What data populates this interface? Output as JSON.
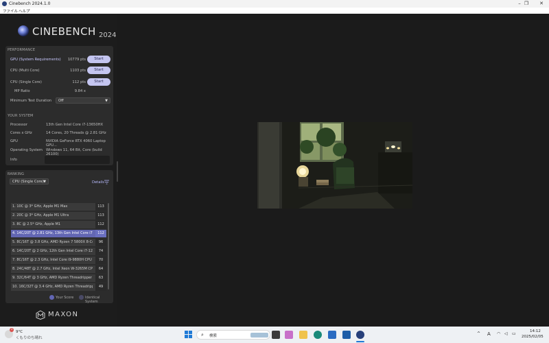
{
  "window": {
    "title": "Cinebench 2024.1.0",
    "minimize": "–",
    "maximize": "❐",
    "close": "✕"
  },
  "menu": {
    "file": "ファイル",
    "help": "ヘルプ"
  },
  "logo": {
    "name": "CINEBENCH",
    "year": "2024"
  },
  "performance": {
    "title": "PERFORMANCE",
    "gpu": {
      "label": "GPU (System Requirements)",
      "value": "10779 pts",
      "button": "Start"
    },
    "cpu_multi": {
      "label": "CPU (Multi Core)",
      "value": "1103 pts",
      "button": "Start"
    },
    "cpu_single": {
      "label": "CPU (Single Core)",
      "value": "112 pts",
      "button": "Start"
    },
    "mp_ratio": {
      "label": "MP Ratio",
      "value": "9.84 x"
    },
    "min_duration": {
      "label": "Minimum Test Duration",
      "value": "Off"
    }
  },
  "system": {
    "title": "YOUR SYSTEM",
    "processor": {
      "label": "Processor",
      "value": "13th Gen Intel Core i7-13650HX"
    },
    "cores": {
      "label": "Cores x GHz",
      "value": "14 Cores, 20 Threads @ 2.81 GHz"
    },
    "gpu": {
      "label": "GPU",
      "value": "NVIDIA GeForce RTX 4060 Laptop GPU..."
    },
    "os": {
      "label": "Operating System",
      "value": "Windows 11, 64 Bit, Core (build 26100)"
    },
    "info": {
      "label": "Info",
      "value": ""
    }
  },
  "ranking": {
    "title": "RANKING",
    "selected_test": "CPU (Single Core)",
    "details": "Details",
    "rows": [
      {
        "label": "1. 10C @ 3* GHz, Apple M1 Max",
        "score": "113",
        "highlight": false
      },
      {
        "label": "2. 20C @ 3* GHz, Apple M1 Ultra",
        "score": "113",
        "highlight": false
      },
      {
        "label": "3. 8C @ 2.5* GHz, Apple M1",
        "score": "112",
        "highlight": false
      },
      {
        "label": "4. 14C/20T @ 2.81 GHz, 13th Gen Intel Core i7-13...",
        "score": "112",
        "highlight": true
      },
      {
        "label": "5. 8C/16T @ 3.8 GHz, AMD Ryzen 7 5800X 8-Core ...",
        "score": "96",
        "highlight": false
      },
      {
        "label": "6. 14C/20T @ 2 GHz, 12th Gen Intel Core i7-1280P",
        "score": "74",
        "highlight": false
      },
      {
        "label": "7. 8C/16T @ 2.3 GHz, Intel Core i9-9880H CPU",
        "score": "70",
        "highlight": false
      },
      {
        "label": "8. 24C/48T @ 2.7 GHz, Intel Xeon W-3265M CPU",
        "score": "64",
        "highlight": false
      },
      {
        "label": "9. 32C/64T @ 3 GHz, AMD Ryzen Threadripper 29...",
        "score": "63",
        "highlight": false
      },
      {
        "label": "10. 16C/32T @ 3.4 GHz, AMD Ryzen Threadripper ...",
        "score": "49",
        "highlight": false
      }
    ],
    "legend_your": "Your Score",
    "legend_identical": "Identical System"
  },
  "brand": {
    "name": "MAXON"
  },
  "colors": {
    "accent": "#6266b3",
    "start_button": "#c4c5f0",
    "panel": "#2c2c2c",
    "background": "#1b1b1b"
  },
  "taskbar": {
    "weather_temp": "9°C",
    "weather_desc": "くもりのち晴れ",
    "weather_badge": "1",
    "search_placeholder": "検索",
    "lang": "A",
    "time": "14:12",
    "date": "2025/02/05"
  }
}
